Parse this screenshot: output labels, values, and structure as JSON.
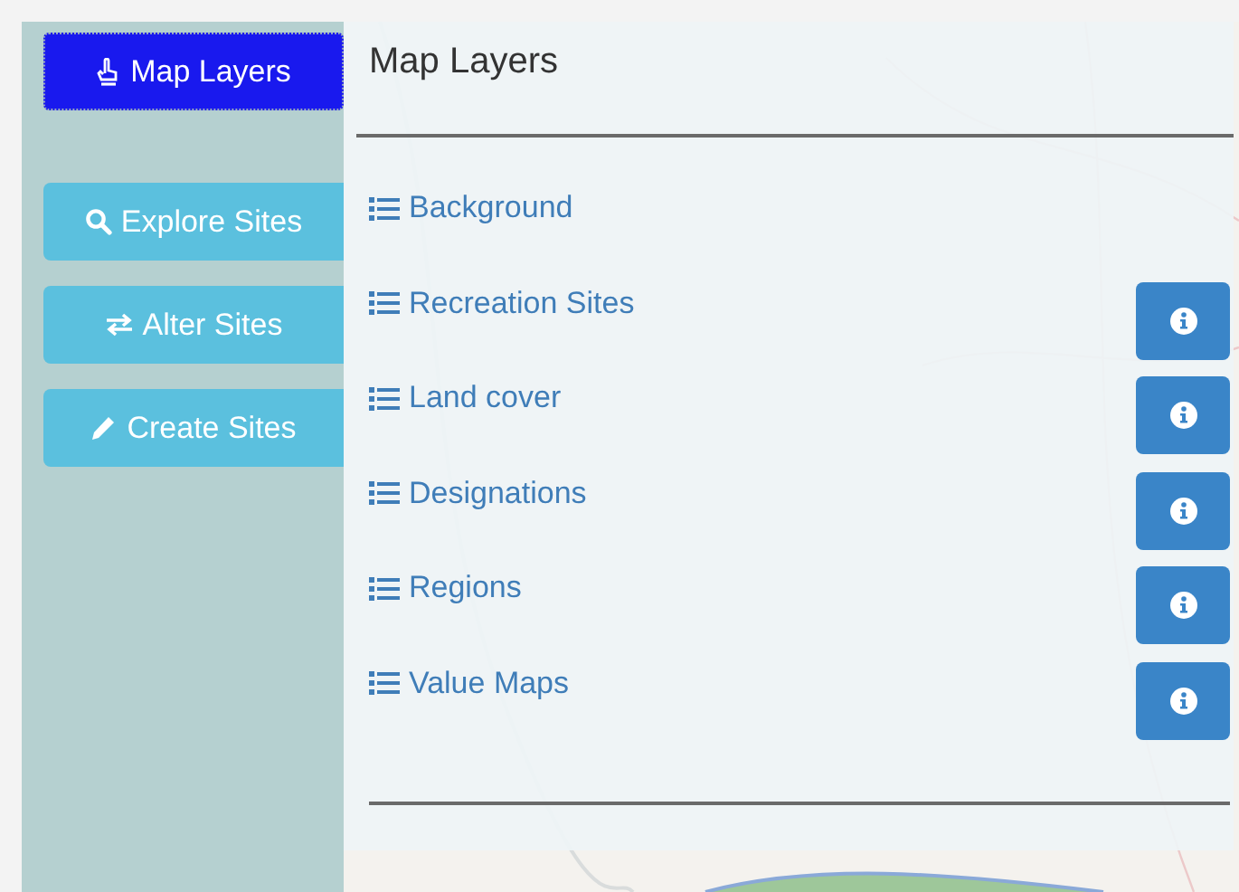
{
  "sidebar": {
    "buttons": [
      {
        "label": "Map Layers",
        "kind": "hand",
        "selected": true
      },
      {
        "label": "Explore Sites",
        "kind": "search",
        "selected": false
      },
      {
        "label": "Alter Sites",
        "kind": "exchange",
        "selected": false
      },
      {
        "label": "Create Sites",
        "kind": "pencil",
        "selected": false
      }
    ]
  },
  "panel": {
    "title": "Map Layers",
    "layers": [
      {
        "label": "Background",
        "has_info": false
      },
      {
        "label": "Recreation Sites",
        "has_info": true
      },
      {
        "label": "Land cover",
        "has_info": true
      },
      {
        "label": "Designations",
        "has_info": true
      },
      {
        "label": "Regions",
        "has_info": true
      },
      {
        "label": "Value Maps",
        "has_info": true
      }
    ]
  }
}
